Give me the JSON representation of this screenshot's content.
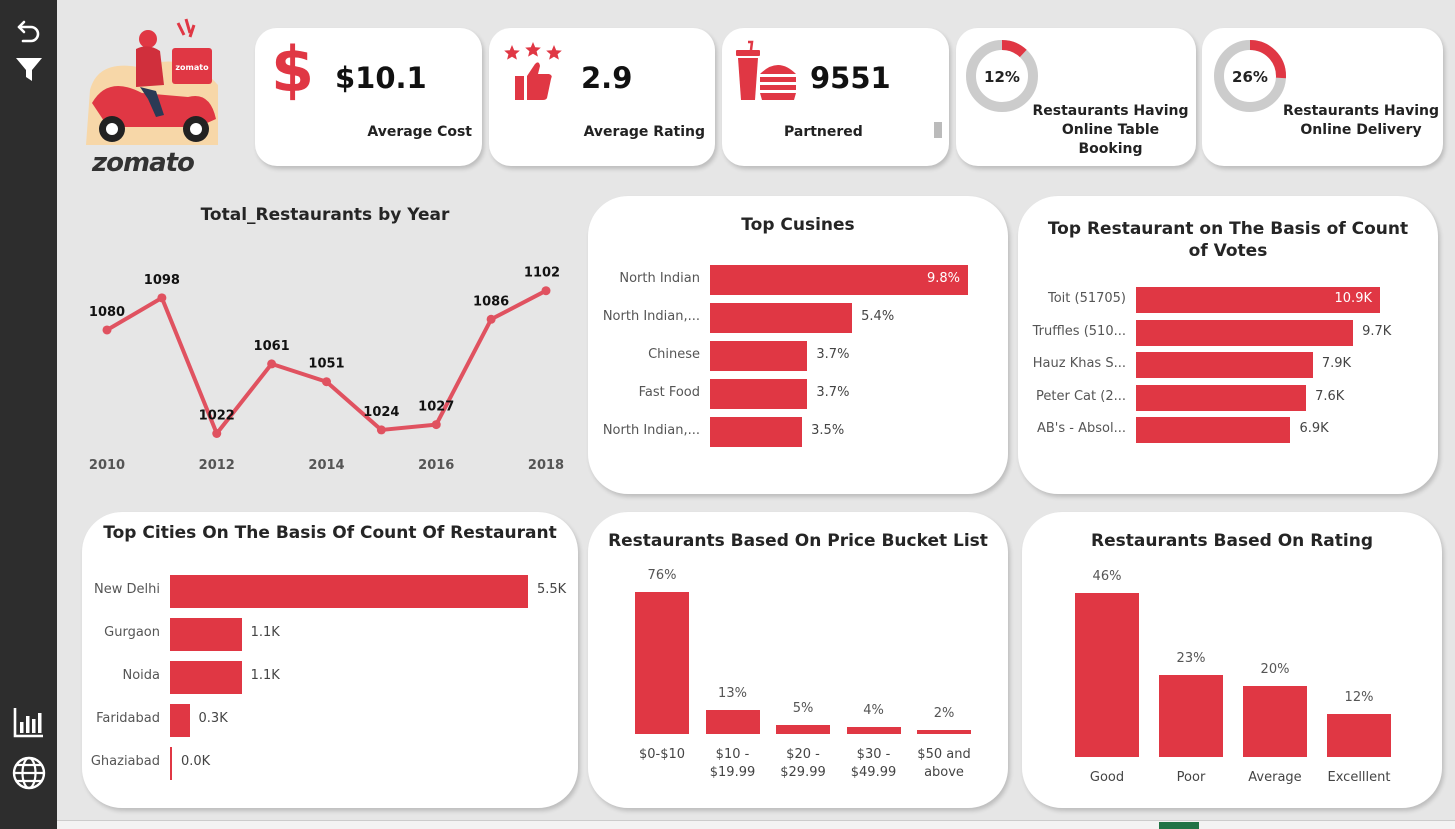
{
  "brand": {
    "name": "zomato",
    "scooter_text": "zomato"
  },
  "colors": {
    "accent": "#e03744",
    "line": "#e05260",
    "sidebar": "#2d2d2d",
    "donut_rest": "#cccccc"
  },
  "sidebar": {
    "icons": [
      "back-arrow-icon",
      "filter-icon",
      "bar-chart-icon",
      "globe-icon"
    ]
  },
  "kpis": [
    {
      "icon": "dollar-icon",
      "value": "$10.1",
      "label": "Average Cost"
    },
    {
      "icon": "stars-thumb-icon",
      "value": "2.9",
      "label": "Average Rating"
    },
    {
      "icon": "fast-food-icon",
      "value": "9551",
      "label": "Partnered"
    }
  ],
  "donuts": [
    {
      "percent_text": "12%",
      "fraction": 0.12,
      "label_line1": "Restaurants Having",
      "label_line2": "Online Table Booking"
    },
    {
      "percent_text": "26%",
      "fraction": 0.26,
      "label_line1": "Restaurants Having",
      "label_line2": "Online Delivery"
    }
  ],
  "chart_data": [
    {
      "type": "line",
      "title": "Total_Restaurants by Year",
      "x": [
        2010,
        2011,
        2012,
        2013,
        2014,
        2015,
        2016,
        2017,
        2018
      ],
      "values": [
        1080,
        1098,
        1022,
        1061,
        1051,
        1024,
        1027,
        1086,
        1102
      ],
      "data_labels": [
        "1080",
        "1098",
        "1022",
        "1061",
        "1051",
        "1024",
        "1027",
        "1086",
        "1102"
      ],
      "tick_labels": [
        "2010",
        "2012",
        "2014",
        "2016",
        "2018"
      ],
      "ylim": [
        1015,
        1108
      ]
    },
    {
      "type": "bar",
      "orientation": "horizontal",
      "title": "Top Cusines",
      "categories": [
        "North Indian",
        "North Indian,...",
        "Chinese",
        "Fast Food",
        "North Indian,..."
      ],
      "values": [
        9.8,
        5.4,
        3.7,
        3.7,
        3.5
      ],
      "data_labels": [
        "9.8%",
        "5.4%",
        "3.7%",
        "3.7%",
        "3.5%"
      ],
      "xlim": [
        0,
        9.8
      ]
    },
    {
      "type": "bar",
      "orientation": "horizontal",
      "title": "Top Restaurant on The Basis of Count of Votes",
      "categories": [
        "Toit (51705)",
        "Truffles (510...",
        "Hauz Khas S...",
        "Peter Cat (2...",
        "AB's - Absol..."
      ],
      "values": [
        10.9,
        9.7,
        7.9,
        7.6,
        6.9
      ],
      "data_labels": [
        "10.9K",
        "9.7K",
        "7.9K",
        "7.6K",
        "6.9K"
      ],
      "xlim": [
        0,
        10.9
      ]
    },
    {
      "type": "bar",
      "orientation": "horizontal",
      "title": "Top Cities On The Basis Of Count Of Restaurant",
      "categories": [
        "New Delhi",
        "Gurgaon",
        "Noida",
        "Faridabad",
        "Ghaziabad"
      ],
      "values": [
        5.5,
        1.1,
        1.1,
        0.3,
        0.0
      ],
      "data_labels": [
        "5.5K",
        "1.1K",
        "1.1K",
        "0.3K",
        "0.0K"
      ],
      "xlim": [
        0,
        5.5
      ]
    },
    {
      "type": "bar",
      "title": "Restaurants Based On Price Bucket List",
      "categories": [
        "$0-$10",
        "$10 - $19.99",
        "$20 - $29.99",
        "$30 - $49.99",
        "$50 and above"
      ],
      "category_lines": [
        [
          "$0-$10"
        ],
        [
          "$10 -",
          "$19.99"
        ],
        [
          "$20 -",
          "$29.99"
        ],
        [
          "$30 -",
          "$49.99"
        ],
        [
          "$50 and",
          "above"
        ]
      ],
      "values": [
        76,
        13,
        5,
        4,
        2
      ],
      "data_labels": [
        "76%",
        "13%",
        "5%",
        "4%",
        "2%"
      ],
      "ylim": [
        0,
        76
      ]
    },
    {
      "type": "bar",
      "title": "Restaurants Based On Rating",
      "categories": [
        "Good",
        "Poor",
        "Average",
        "Excellent"
      ],
      "category_labels": [
        "Good",
        "Poor",
        "Average",
        "Excelllent"
      ],
      "values": [
        46,
        23,
        20,
        12
      ],
      "data_labels": [
        "46%",
        "23%",
        "20%",
        "12%"
      ],
      "ylim": [
        0,
        46
      ]
    }
  ]
}
